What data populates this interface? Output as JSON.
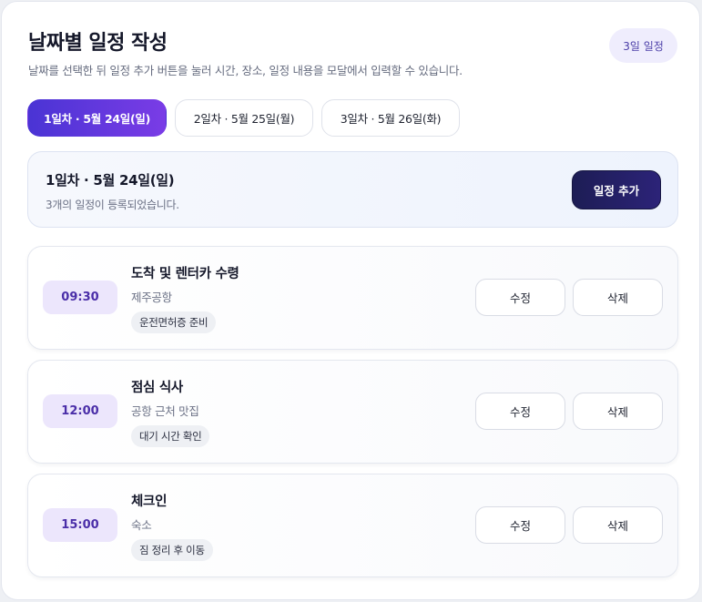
{
  "header": {
    "title": "날짜별 일정 작성",
    "subtitle": "날짜를 선택한 뒤 일정 추가 버튼을 눌러 시간, 장소, 일정 내용을 모달에서 입력할 수 있습니다.",
    "days_badge": "3일 일정"
  },
  "tabs": [
    {
      "label": "1일차 · 5월 24일(일)",
      "active": true
    },
    {
      "label": "2일차 · 5월 25일(월)",
      "active": false
    },
    {
      "label": "3일차 · 5월 26일(화)",
      "active": false
    }
  ],
  "summary": {
    "title": "1일차 · 5월 24일(일)",
    "count_text": "3개의 일정이 등록되었습니다.",
    "add_button_label": "일정 추가"
  },
  "events": [
    {
      "time": "09:30",
      "title": "도착 및 렌터카 수령",
      "place": "제주공항",
      "note": "운전면허증 준비",
      "edit_label": "수정",
      "delete_label": "삭제"
    },
    {
      "time": "12:00",
      "title": "점심 식사",
      "place": "공항 근처 맛집",
      "note": "대기 시간 확인",
      "edit_label": "수정",
      "delete_label": "삭제"
    },
    {
      "time": "15:00",
      "title": "체크인",
      "place": "숙소",
      "note": "짐 정리 후 이동",
      "edit_label": "수정",
      "delete_label": "삭제"
    }
  ],
  "colors": {
    "accent_start": "#4a34d4",
    "accent_end": "#7a3ce6",
    "primary_button": "#1d1d55",
    "time_chip_bg": "#ece6fc",
    "time_chip_text": "#4a2ea8"
  }
}
